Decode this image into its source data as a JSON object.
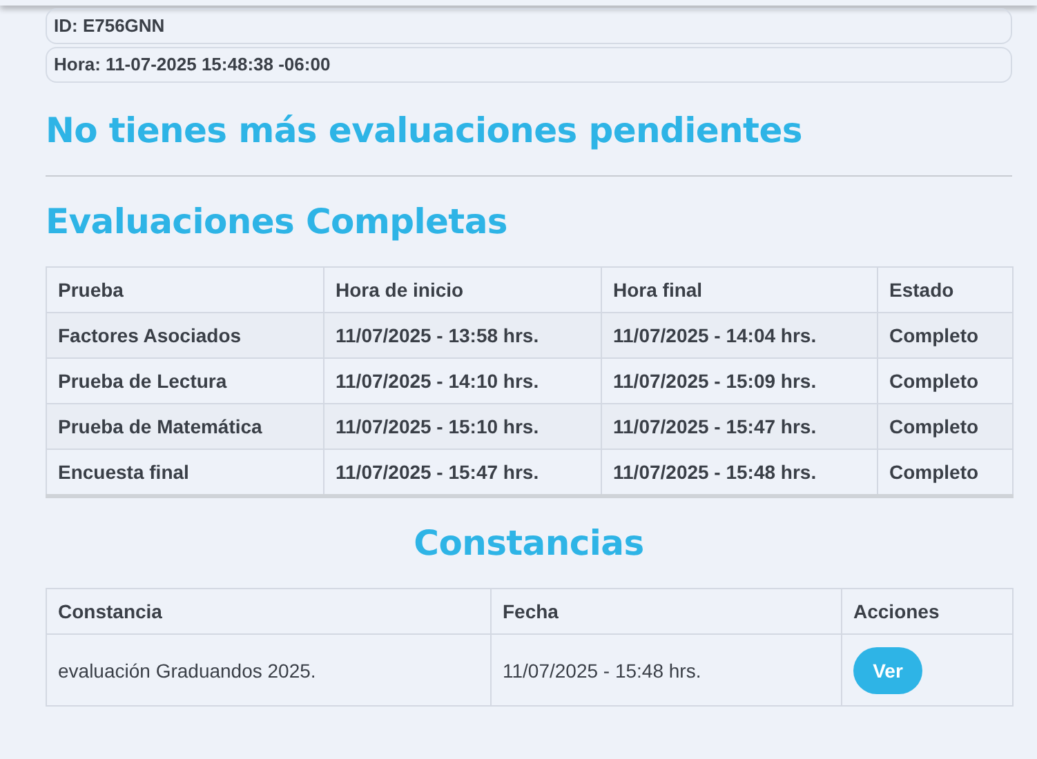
{
  "info": [
    {
      "text": "ID: E756GNN"
    },
    {
      "text": "Hora: 11-07-2025 15:48:38 -06:00"
    }
  ],
  "pending_message": "No tienes más evaluaciones pendientes",
  "completed": {
    "title": "Evaluaciones Completas",
    "columns": [
      "Prueba",
      "Hora de inicio",
      "Hora final",
      "Estado"
    ],
    "rows": [
      [
        "Factores Asociados",
        "11/07/2025 - 13:58 hrs.",
        "11/07/2025 - 14:04 hrs.",
        "Completo"
      ],
      [
        "Prueba de Lectura",
        "11/07/2025 - 14:10 hrs.",
        "11/07/2025 - 15:09 hrs.",
        "Completo"
      ],
      [
        "Prueba de Matemática",
        "11/07/2025 - 15:10 hrs.",
        "11/07/2025 - 15:47 hrs.",
        "Completo"
      ],
      [
        "Encuesta final",
        "11/07/2025 - 15:47 hrs.",
        "11/07/2025 - 15:48 hrs.",
        "Completo"
      ]
    ]
  },
  "certificates": {
    "title": "Constancias",
    "columns": [
      "Constancia",
      "Fecha",
      "Acciones"
    ],
    "rows": [
      {
        "name": "evaluación Graduandos 2025.",
        "date": "11/07/2025 - 15:48 hrs.",
        "action": "Ver"
      }
    ]
  }
}
